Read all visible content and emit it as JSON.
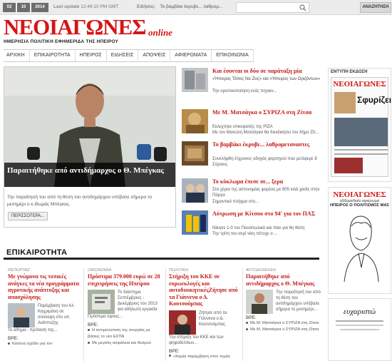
{
  "topbar": {
    "day": "02",
    "month": "10",
    "year": "2014",
    "last_update_label": "Last update",
    "last_update_value": "12:49:10 PM GMT",
    "flash_label": "Ειδήσεις:",
    "flash_text": "Το βαμβάκι έκρυβε... λαθρομ...",
    "search_placeholder": "",
    "search_button": "ΑΝΑΖΗΤΗΣΗ"
  },
  "logo": {
    "name": "ΝΕΟΙΑΓΩΝΕΣ",
    "online": "online",
    "tagline": "ΗΜΕΡΗΣΙΑ ΠΟΛΙΤΙΚΗ ΕΦΗΜΕΡΙΔΑ ΤΗΣ ΗΠΕΙΡΟΥ"
  },
  "nav": [
    "ΑΡΧΙΚΗ",
    "ΕΠΙΚΑΙΡΟΤΗΤΑ",
    "ΗΠΕΙΡΟΣ",
    "ΕΙΔΗΣΕΙΣ",
    "ΑΠΟΨΕΙΣ",
    "ΑΦΙΕΡΩΜΑΤΑ",
    "ΕΠΙΚΟΙΝΩΝΙΑ"
  ],
  "lead": {
    "title": "Παραιτήθηκε από αντιδήμαρχος ο Θ. Μπέγκας",
    "text": "Την παραίτησή του από τη θέση του αντιδημάρχου υπέβαλε σήμερα το μεσημέρι ο κ.Θωμάς Μπέγκας.",
    "more": "ΠΕΡΙΣΣΟΤΕΡΑ..."
  },
  "side_news": [
    {
      "title": "Και έσονται οι δύο σε παράταξη μία",
      "title2": "«Ήπειρος Τόπος Να Ζεις» και «Ήπειρος των Οριζόντων»",
      "summary": "Την οριστικοποίηση ενός πηγαιν..."
    },
    {
      "title": "Με Μ. Ματσάγκα ο ΣΥΡΙΖΑ στη Ζίτσα",
      "summary": "Εκλεχτηκε επικεφαλής της ΡΙΖΑ",
      "summary2": "Με τον Μανώλη Ματσάγκα θα διεκδικήσει τον δήμο Ζίτ..."
    },
    {
      "title": "Το βαμβάκι έκρυβε... λαθρομεταναστες",
      "summary": "Συνελήφθη έτχρονος οδηγός φορτηγού που μετέφερε 8 Σύριους"
    },
    {
      "title": "Το κύκλωμα έπεσε σε... ξερα",
      "summary": "Στα χέρια της αστυνομίας φορέας με 805 κιλά χασίς στην Πάργα",
      "summary2": "Σημαντικό πλήγμα στο..."
    },
    {
      "title": "Λύτρωση με Κίτσου στο 94' για τον ΠΑΣ",
      "summary": "Νίκησε 1-0 τον Πανσιτωλικό και πάει για 6η θέση",
      "summary2": "Την τρίτη του σερί νίκη πέτυχε ο ..."
    }
  ],
  "right": {
    "print_label": "ΕΝΤΥΠΗ ΕΚΔΟΣΗ",
    "paper_name": "ΝΕΟΙΑΓΩΝΕΣ",
    "paper_headline": "Σφυρίζει",
    "weekly_name": "ΝΕΟΙΑΓΩΝΕΣ",
    "weekly_sub": "εβδομαδιαίο αφιέρωμα",
    "weekly_title": "ΗΠΕΙΡΟΣ Ο ΠΟΛΙΤΙΣΜΟΣ ΜΑΣ",
    "ad_text": "ευχαριστώ"
  },
  "section": {
    "title": "ΕΠΙΚΑΙΡΟΤΗΤΑ"
  },
  "columns": [
    {
      "cat": "ΡΕΠΟΡΤΑΖ",
      "title": "Με γνώμονα τις τοπικές ανάγκες τα νέα προγράμματα αγροτικής ανάπτυξης και απασχόλησης",
      "text": "Παρέμβαση του Αλ. Καχριμάνη σε σύσκεψη στο υπ. Ανάπτυξης",
      "text2": "Το αίτημα - πρόταση της...",
      "more": "ΒΡΕ:",
      "bullet": "Κανένα σχέδιο για τον"
    },
    {
      "cat": "ΟΙΚΟΝΟΜΙΑ",
      "title": "Πρόστιμα 379.000 ευρώ σε 28 επιχειρήσεις της Ηπείρου",
      "text": "Το διάστημα Σεπτέμβριος - Δεκέμβριος του 2013 για αδήλωτη εργασία",
      "text2": "Πρόστιμα ύψους...",
      "more": "ΒΡΕ:",
      "bullet": "Η αντιμετώπιση της ανεργίας με βάσεις το νέο ΕΣΠΑ",
      "bullet2": "Με μεγάλη ασφάλεια και θεσμού"
    },
    {
      "cat": "ΠΟΛΙΤΙΚΗ",
      "title": "Στήριξη του ΚΚΕ σε ευρωεκλογές και αυτοδιοικητικέςΖήτησε από τα Γιάννενα ο Δ. Κουτσούμπας",
      "text": "Ζήτησε από τα Γιάννενα ο Δ. Κουτσούμπας",
      "text2": "Την στήριξη του ΚΚΕ και των ψηφοδελτίων...",
      "more": "ΒΡΕ:",
      "bullet": "«Καμία παρέμβαση στον τομέα"
    },
    {
      "cat": "ΑΥΤΟΔΙΟΙΚΗΣΗ",
      "title": "Παραιτήθηκε από αντιδήμαρχος ο Θ. Μπέγκας",
      "text": "Την παραίτησή του από τη θέση του αντιδημάρχου υπέβαλε σήμερα το μεσημέρι...",
      "more": "ΒΡΕ:",
      "bullet": "Με Μ. Ματσάγκα ο ΣΥΡΙΖΑ στη Ζίτσα",
      "bullet2": "Με Μ. Ματσάγκα ο ΣΥΡΙΖΑ στη Ζίτσα"
    }
  ],
  "colors": {
    "brand_red": "#d51515",
    "link_red": "#c31818"
  }
}
